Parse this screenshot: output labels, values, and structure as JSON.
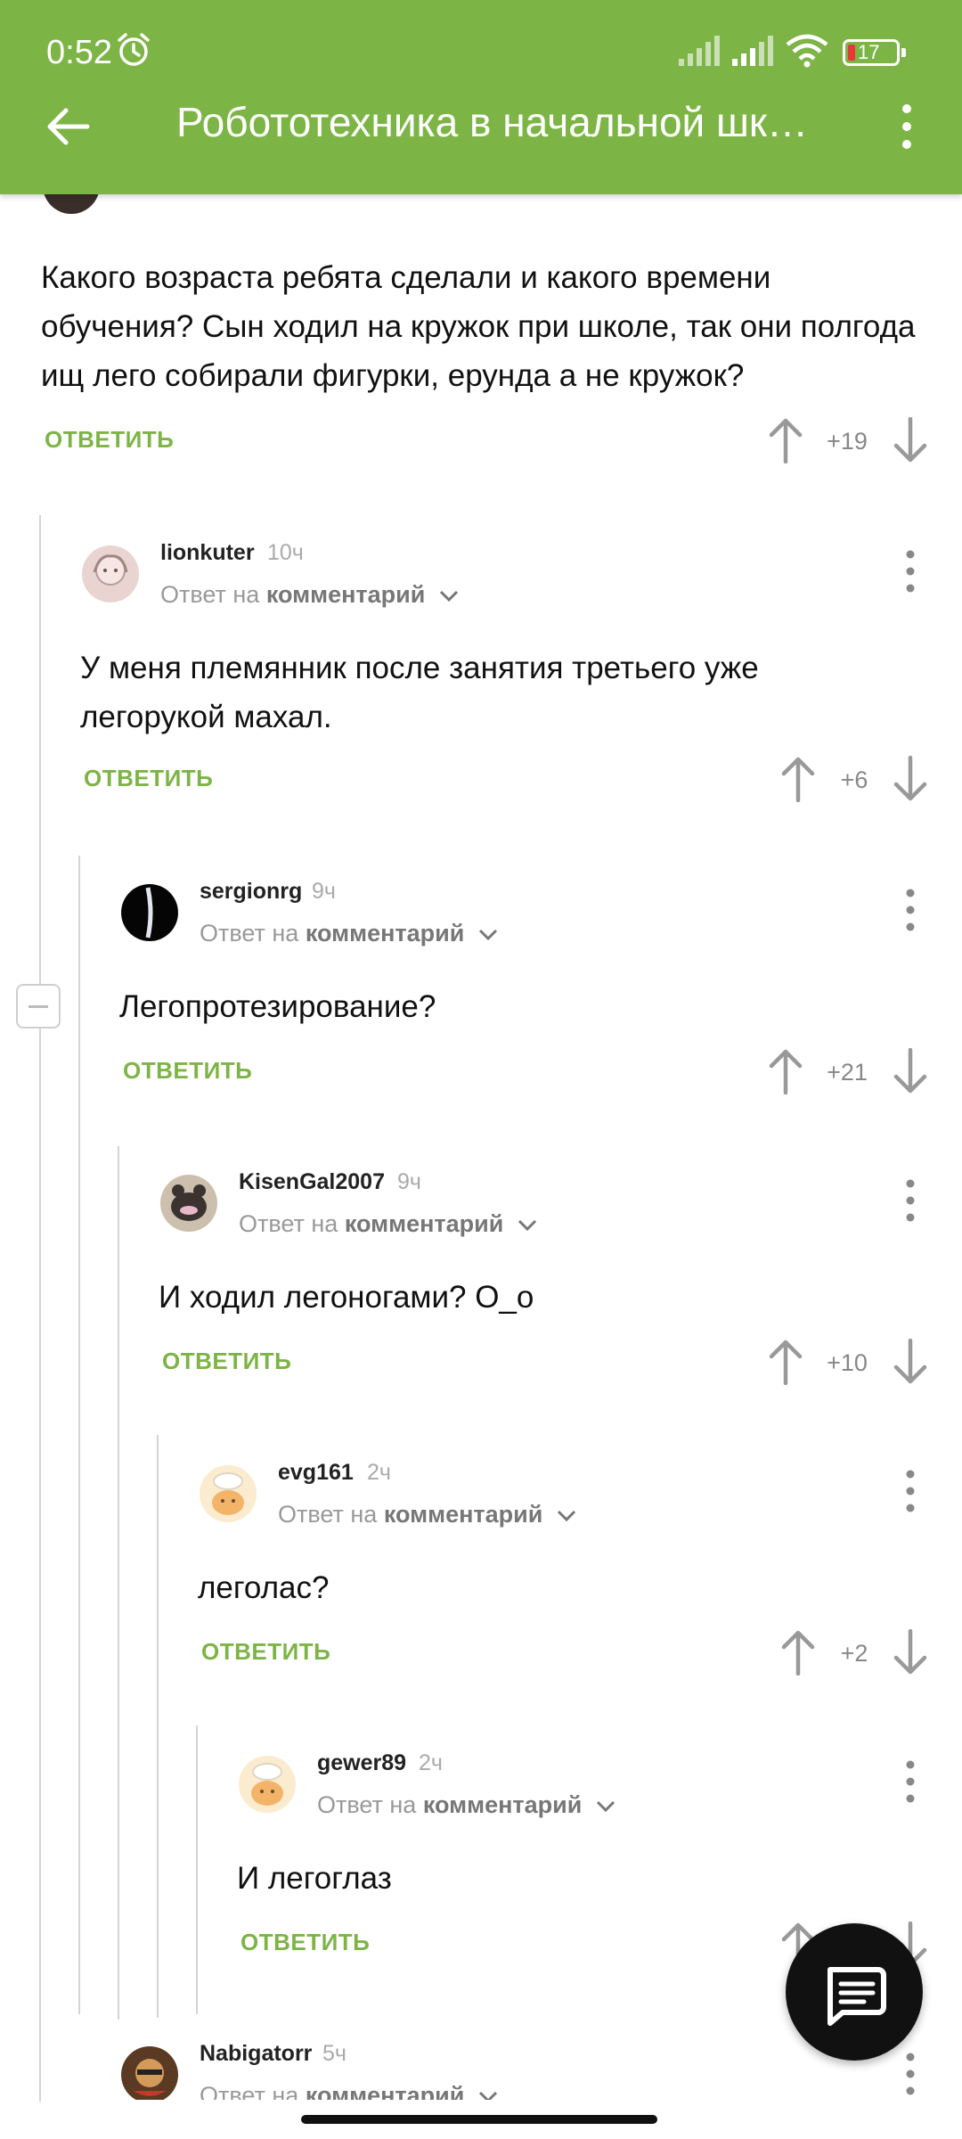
{
  "status_bar": {
    "time": "0:52",
    "battery": "17"
  },
  "toolbar": {
    "title": "Робототехника в начальной шк…"
  },
  "root_comment": {
    "text": "Какого возраста ребята сделали и какого времени обучения? Сын ходил на кружок при школе, так они полгода ищ лего собирали фигурки, ерунда а не кружок?",
    "reply_label": "ОТВЕТИТЬ",
    "score": "+19"
  },
  "comments": [
    {
      "author": "lionkuter",
      "time": "10ч",
      "reply_prefix": "Ответ на",
      "reply_target": "комментарий",
      "text": "У меня племянник после занятия третьего уже легорукой махал.",
      "reply_label": "ОТВЕТИТЬ",
      "score": "+6"
    },
    {
      "author": "sergionrg",
      "time": "9ч",
      "reply_prefix": "Ответ на",
      "reply_target": "комментарий",
      "text": "Легопротезирование?",
      "reply_label": "ОТВЕТИТЬ",
      "score": "+21"
    },
    {
      "author": "KisenGal2007",
      "time": "9ч",
      "reply_prefix": "Ответ на",
      "reply_target": "комментарий",
      "text": "И ходил легоногами? О_о",
      "reply_label": "ОТВЕТИТЬ",
      "score": "+10"
    },
    {
      "author": "evg161",
      "time": "2ч",
      "reply_prefix": "Ответ на",
      "reply_target": "комментарий",
      "text": "леголас?",
      "reply_label": "ОТВЕТИТЬ",
      "score": "+2"
    },
    {
      "author": "gewer89",
      "time": "2ч",
      "reply_prefix": "Ответ на",
      "reply_target": "комментарий",
      "text": "И легоглаз",
      "reply_label": "ОТВЕТИТЬ",
      "score": ""
    },
    {
      "author": "Nabigatorr",
      "time": "5ч",
      "reply_prefix": "Ответ на",
      "reply_target": "комментарий",
      "text": "",
      "reply_label": "",
      "score": ""
    }
  ],
  "icons": {
    "back": "arrow-left-icon",
    "more": "more-vertical-icon",
    "upvote": "arrow-up-icon",
    "downvote": "arrow-down-icon",
    "fab": "message-icon",
    "collapse": "minus-icon"
  },
  "colors": {
    "accent": "#7db446",
    "text": "#111111",
    "muted": "#999999",
    "fab": "#111111"
  }
}
